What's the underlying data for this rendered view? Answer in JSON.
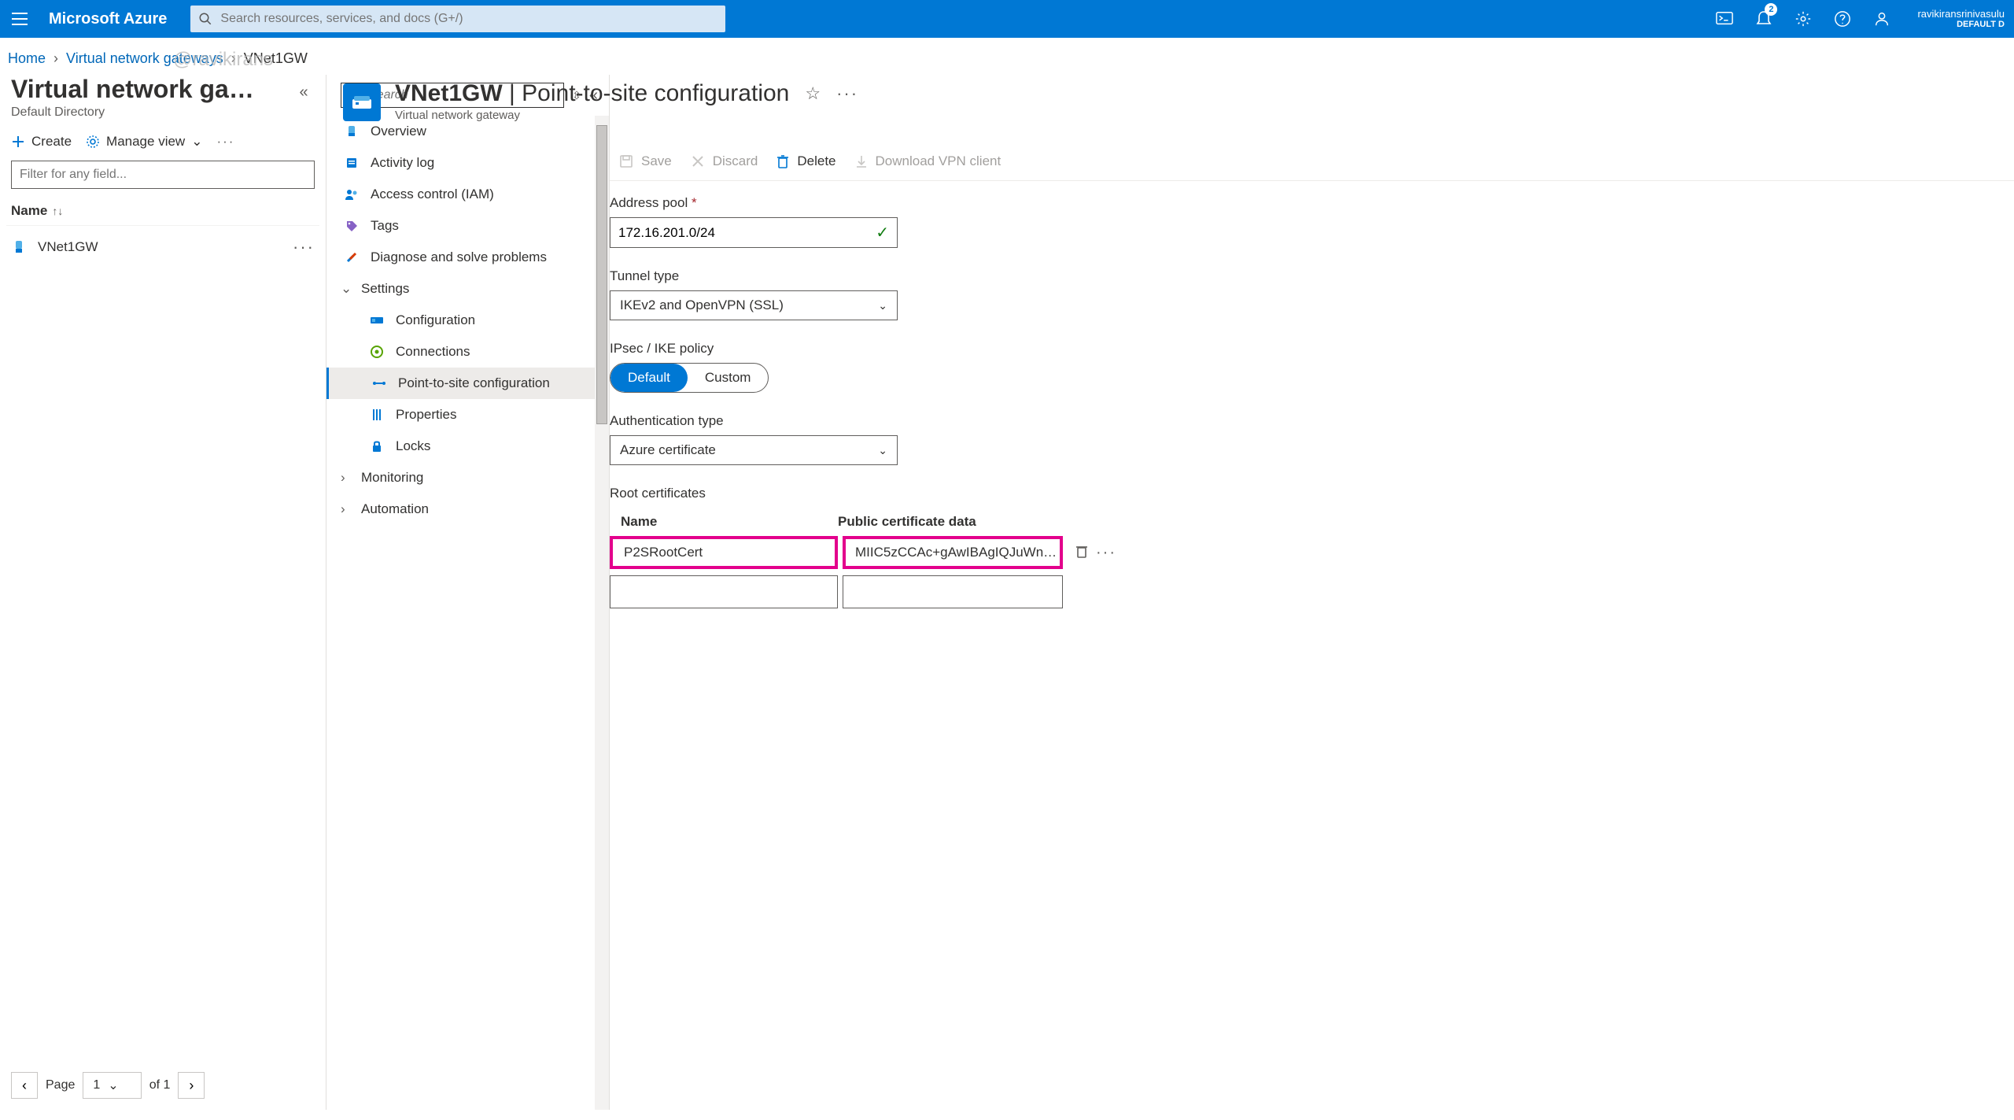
{
  "topbar": {
    "brand": "Microsoft Azure",
    "search_placeholder": "Search resources, services, and docs (G+/)",
    "notification_count": "2",
    "account_name": "ravikiransrinivasulu",
    "account_dir": "DEFAULT D"
  },
  "breadcrumb": {
    "home": "Home",
    "level1": "Virtual network gateways",
    "current": "VNet1GW"
  },
  "watermark": "@ravikirans",
  "left_panel": {
    "title": "Virtual network ga…",
    "subtitle": "Default Directory",
    "create": "Create",
    "manage_view": "Manage view",
    "filter_placeholder": "Filter for any field...",
    "col_name": "Name",
    "item": "VNet1GW",
    "page_label": "Page",
    "page_value": "1",
    "page_total": "of 1"
  },
  "nav": {
    "search_placeholder": "Search",
    "items": {
      "overview": "Overview",
      "activity": "Activity log",
      "iam": "Access control (IAM)",
      "tags": "Tags",
      "diagnose": "Diagnose and solve problems",
      "settings": "Settings",
      "configuration": "Configuration",
      "connections": "Connections",
      "p2s": "Point-to-site configuration",
      "properties": "Properties",
      "locks": "Locks",
      "monitoring": "Monitoring",
      "automation": "Automation"
    }
  },
  "blade": {
    "resource": "VNet1GW",
    "page": "Point-to-site configuration",
    "type": "Virtual network gateway",
    "cmd": {
      "save": "Save",
      "discard": "Discard",
      "delete": "Delete",
      "download": "Download VPN client"
    }
  },
  "form": {
    "address_pool_label": "Address pool",
    "address_pool_value": "172.16.201.0/24",
    "tunnel_type_label": "Tunnel type",
    "tunnel_type_value": "IKEv2 and OpenVPN (SSL)",
    "ipsec_label": "IPsec / IKE policy",
    "ipsec_default": "Default",
    "ipsec_custom": "Custom",
    "auth_label": "Authentication type",
    "auth_value": "Azure certificate",
    "root_cert_label": "Root certificates",
    "cert_col_name": "Name",
    "cert_col_data": "Public certificate data",
    "cert1_name": "P2SRootCert",
    "cert1_data": "MIIC5zCCAc+gAwIBAgIQJuWn…"
  }
}
